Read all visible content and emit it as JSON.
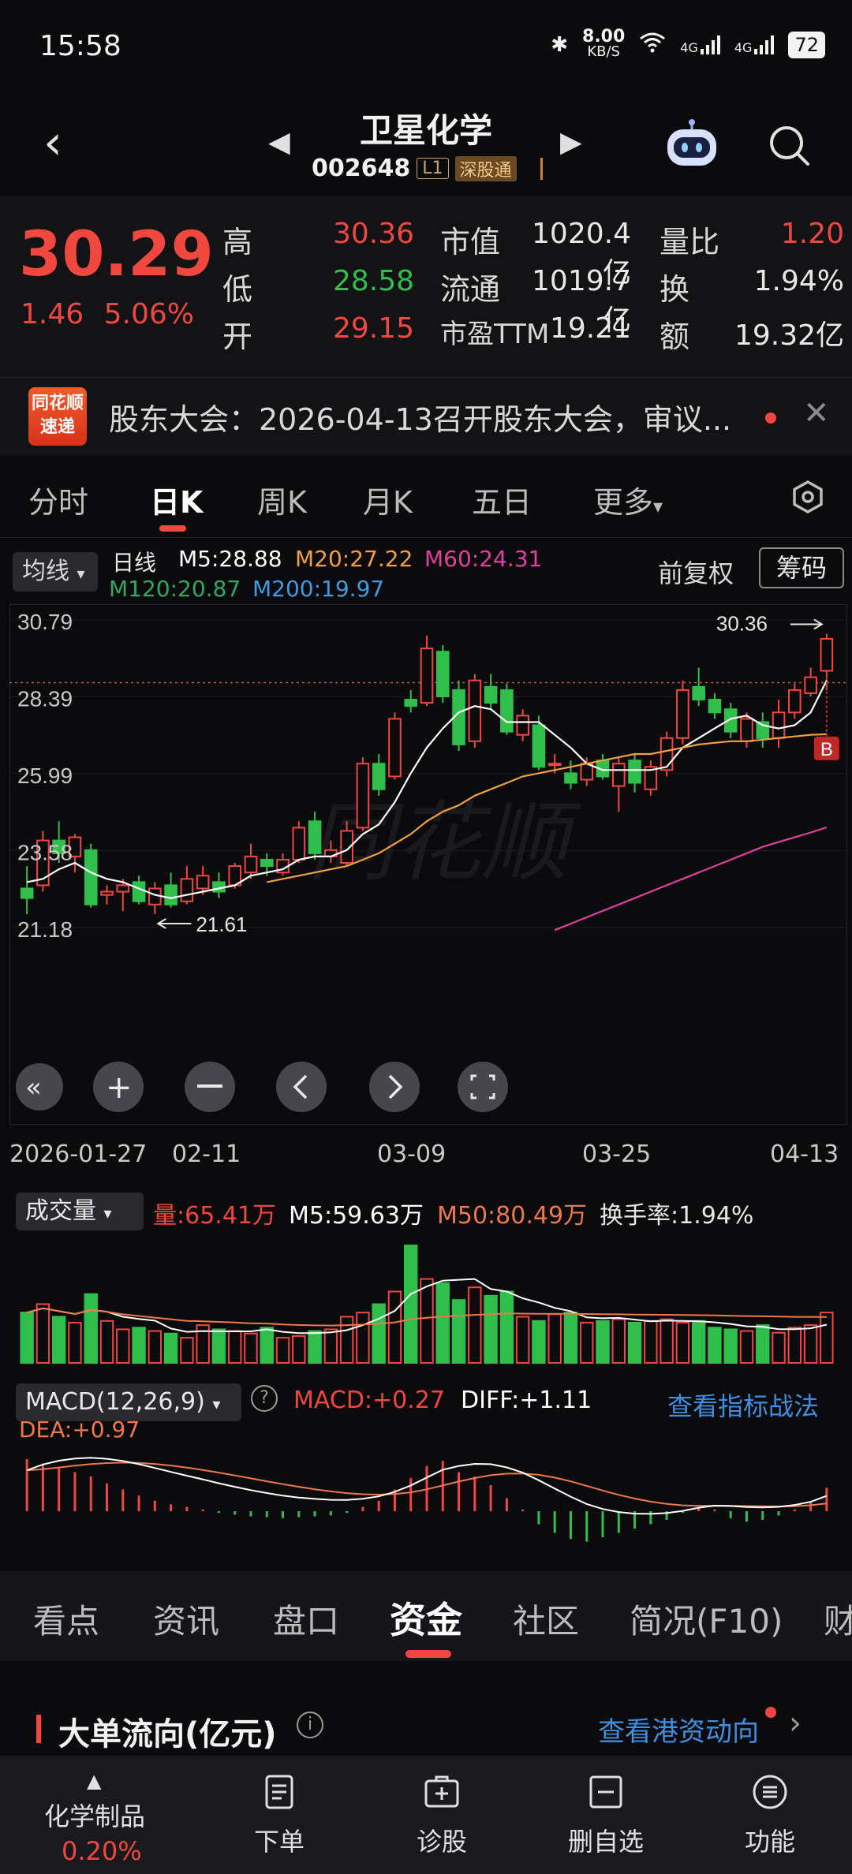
{
  "status_bar": {
    "time": "15:58",
    "network_speed": "8.00",
    "network_unit": "KB/S",
    "signal_1": "4G",
    "signal_2": "4G",
    "battery": "72"
  },
  "header": {
    "stock_name": "卫星化学",
    "stock_code": "002648",
    "tag_level": "L1",
    "tag_connect": "深股通"
  },
  "quote": {
    "last_price": "30.29",
    "change": "1.46",
    "change_pct": "5.06%",
    "high_label": "高",
    "high": "30.36",
    "low_label": "低",
    "low": "28.58",
    "open_label": "开",
    "open": "29.15",
    "mcap_label": "市值",
    "mcap": "1020.4亿",
    "float_label": "流通",
    "float": "1019.7亿",
    "pe_label": "市盈TTM",
    "pe": "19.21",
    "volratio_label": "量比",
    "volratio": "1.20",
    "turnover_label": "换",
    "turnover": "1.94%",
    "amount_label": "额",
    "amount": "19.32亿"
  },
  "news": {
    "logo_line1": "同花顺",
    "logo_line2": "速递",
    "text": "股东大会：2026-04-13召开股东大会，审议..."
  },
  "period_tabs": [
    "分时",
    "日K",
    "周K",
    "月K",
    "五日",
    "更多"
  ],
  "period_active": "日K",
  "ma_legend": {
    "selector": "均线",
    "period": "日线",
    "m5": "M5:28.88",
    "m20": "M20:27.22",
    "m60": "M60:24.31",
    "m120": "M120:20.87",
    "m200": "M200:19.97",
    "adjust": "前复权",
    "chips": "筹码"
  },
  "colors": {
    "up": "#f0473f",
    "down": "#2fbf4a",
    "m5": "#ffffff",
    "m20": "#f0a040",
    "m60": "#e040a0",
    "m120": "#2fa860",
    "m200": "#3f9be0"
  },
  "chart_data": {
    "type": "candlestick",
    "y_ticks": [
      "30.79",
      "28.39",
      "25.99",
      "23.58",
      "21.18"
    ],
    "ylim": [
      21.18,
      30.79
    ],
    "high_marker": "30.36",
    "low_marker": "21.61",
    "reference_price": 28.83,
    "buy_marker": "B",
    "x_ticks": [
      "2026-01-27",
      "02-11",
      "03-09",
      "03-25",
      "04-13"
    ],
    "candles": [
      {
        "o": 22.4,
        "c": 22.1,
        "h": 23.1,
        "l": 21.6
      },
      {
        "o": 22.5,
        "c": 23.9,
        "h": 24.2,
        "l": 22.3
      },
      {
        "o": 23.9,
        "c": 23.5,
        "h": 24.5,
        "l": 23.2
      },
      {
        "o": 23.4,
        "c": 24.0,
        "h": 24.1,
        "l": 22.9
      },
      {
        "o": 23.6,
        "c": 21.9,
        "h": 23.8,
        "l": 21.8
      },
      {
        "o": 22.2,
        "c": 22.3,
        "h": 22.5,
        "l": 21.9
      },
      {
        "o": 22.3,
        "c": 22.5,
        "h": 22.7,
        "l": 21.7
      },
      {
        "o": 22.6,
        "c": 22.0,
        "h": 22.8,
        "l": 21.9
      },
      {
        "o": 21.9,
        "c": 22.4,
        "h": 22.6,
        "l": 21.6
      },
      {
        "o": 22.5,
        "c": 21.9,
        "h": 22.9,
        "l": 21.8
      },
      {
        "o": 22.0,
        "c": 22.7,
        "h": 23.1,
        "l": 21.9
      },
      {
        "o": 22.4,
        "c": 22.8,
        "h": 23.1,
        "l": 22.2
      },
      {
        "o": 22.6,
        "c": 22.3,
        "h": 22.9,
        "l": 22.1
      },
      {
        "o": 22.5,
        "c": 23.1,
        "h": 23.2,
        "l": 22.4
      },
      {
        "o": 22.9,
        "c": 23.4,
        "h": 23.8,
        "l": 22.7
      },
      {
        "o": 23.3,
        "c": 23.1,
        "h": 23.5,
        "l": 22.8
      },
      {
        "o": 22.9,
        "c": 23.3,
        "h": 23.5,
        "l": 22.8
      },
      {
        "o": 23.3,
        "c": 24.3,
        "h": 24.5,
        "l": 23.2
      },
      {
        "o": 24.5,
        "c": 23.5,
        "h": 24.8,
        "l": 23.3
      },
      {
        "o": 23.4,
        "c": 23.6,
        "h": 23.9,
        "l": 23.2
      },
      {
        "o": 23.2,
        "c": 24.2,
        "h": 24.5,
        "l": 23.1
      },
      {
        "o": 24.3,
        "c": 26.3,
        "h": 26.5,
        "l": 24.2
      },
      {
        "o": 26.3,
        "c": 25.5,
        "h": 26.6,
        "l": 25.3
      },
      {
        "o": 25.9,
        "c": 27.7,
        "h": 27.9,
        "l": 25.8
      },
      {
        "o": 28.3,
        "c": 28.1,
        "h": 28.6,
        "l": 27.9
      },
      {
        "o": 28.2,
        "c": 29.9,
        "h": 30.3,
        "l": 28.1
      },
      {
        "o": 29.8,
        "c": 28.4,
        "h": 30.0,
        "l": 28.2
      },
      {
        "o": 28.6,
        "c": 26.9,
        "h": 28.9,
        "l": 26.7
      },
      {
        "o": 27.0,
        "c": 28.9,
        "h": 29.1,
        "l": 26.8
      },
      {
        "o": 28.7,
        "c": 28.2,
        "h": 29.1,
        "l": 28.0
      },
      {
        "o": 28.6,
        "c": 27.3,
        "h": 28.8,
        "l": 27.2
      },
      {
        "o": 27.2,
        "c": 27.8,
        "h": 28.0,
        "l": 27.0
      },
      {
        "o": 27.5,
        "c": 26.2,
        "h": 27.8,
        "l": 26.1
      },
      {
        "o": 26.3,
        "c": 26.3,
        "h": 26.6,
        "l": 26.0
      },
      {
        "o": 26.0,
        "c": 25.7,
        "h": 26.4,
        "l": 25.5
      },
      {
        "o": 25.8,
        "c": 26.3,
        "h": 26.5,
        "l": 25.6
      },
      {
        "o": 26.4,
        "c": 25.9,
        "h": 26.6,
        "l": 25.8
      },
      {
        "o": 25.6,
        "c": 26.3,
        "h": 26.5,
        "l": 24.8
      },
      {
        "o": 26.4,
        "c": 25.7,
        "h": 26.6,
        "l": 25.4
      },
      {
        "o": 25.5,
        "c": 26.2,
        "h": 26.4,
        "l": 25.3
      },
      {
        "o": 26.1,
        "c": 27.1,
        "h": 27.3,
        "l": 25.9
      },
      {
        "o": 27.1,
        "c": 28.6,
        "h": 28.9,
        "l": 26.9
      },
      {
        "o": 28.7,
        "c": 28.3,
        "h": 29.3,
        "l": 28.1
      },
      {
        "o": 28.3,
        "c": 27.9,
        "h": 28.5,
        "l": 27.7
      },
      {
        "o": 28.0,
        "c": 27.3,
        "h": 28.2,
        "l": 27.1
      },
      {
        "o": 27.0,
        "c": 27.7,
        "h": 27.9,
        "l": 26.8
      },
      {
        "o": 27.6,
        "c": 27.1,
        "h": 27.9,
        "l": 26.8
      },
      {
        "o": 27.1,
        "c": 27.9,
        "h": 28.3,
        "l": 26.8
      },
      {
        "o": 27.9,
        "c": 28.6,
        "h": 28.8,
        "l": 27.7
      },
      {
        "o": 28.5,
        "c": 29.0,
        "h": 29.3,
        "l": 28.4
      },
      {
        "o": 29.2,
        "c": 30.2,
        "h": 30.36,
        "l": 28.6
      }
    ],
    "ma5": [
      22.6,
      22.7,
      23.0,
      23.2,
      22.9,
      22.7,
      22.6,
      22.4,
      22.2,
      22.1,
      22.2,
      22.3,
      22.4,
      22.5,
      22.8,
      22.9,
      23.0,
      23.3,
      23.4,
      23.4,
      23.6,
      24.1,
      24.4,
      25.1,
      26.0,
      26.8,
      27.4,
      27.9,
      28.1,
      28.0,
      27.6,
      27.6,
      27.6,
      27.2,
      26.8,
      26.3,
      26.1,
      26.1,
      26.1,
      26.1,
      26.2,
      26.8,
      27.1,
      27.4,
      27.7,
      27.8,
      27.5,
      27.4,
      27.5,
      27.9,
      28.9
    ],
    "ma20": [
      null,
      null,
      null,
      null,
      null,
      null,
      null,
      null,
      null,
      null,
      null,
      null,
      null,
      null,
      null,
      22.6,
      22.7,
      22.8,
      22.9,
      23.0,
      23.1,
      23.3,
      23.5,
      23.8,
      24.1,
      24.5,
      24.8,
      25.0,
      25.3,
      25.5,
      25.7,
      25.9,
      26.0,
      26.1,
      26.2,
      26.3,
      26.4,
      26.5,
      26.6,
      26.6,
      26.7,
      26.8,
      26.9,
      26.95,
      27.0,
      27.0,
      27.05,
      27.1,
      27.15,
      27.2,
      27.22
    ],
    "ma60": [
      null,
      null,
      null,
      null,
      null,
      null,
      null,
      null,
      null,
      null,
      null,
      null,
      null,
      null,
      null,
      null,
      null,
      null,
      null,
      null,
      null,
      null,
      null,
      null,
      null,
      null,
      null,
      null,
      null,
      null,
      null,
      null,
      null,
      21.1,
      21.3,
      21.5,
      21.7,
      21.9,
      22.1,
      22.3,
      22.5,
      22.7,
      22.9,
      23.1,
      23.3,
      23.5,
      23.7,
      23.85,
      24.0,
      24.15,
      24.31
    ],
    "volume": {
      "label": "成交量",
      "vol": "量:65.41万",
      "m5": "M5:59.63万",
      "m50": "M50:80.49万",
      "turnover": "换手率:1.94%",
      "bars": [
        60,
        70,
        55,
        48,
        82,
        50,
        40,
        42,
        38,
        35,
        30,
        45,
        40,
        38,
        35,
        42,
        30,
        32,
        38,
        40,
        55,
        60,
        70,
        85,
        140,
        100,
        95,
        75,
        90,
        80,
        85,
        55,
        50,
        58,
        60,
        48,
        50,
        52,
        48,
        50,
        52,
        48,
        50,
        42,
        40,
        38,
        45,
        36,
        42,
        45,
        60
      ]
    },
    "macd": {
      "selector": "MACD(12,26,9)",
      "macd": "MACD:+0.27",
      "diff": "DIFF:+1.11",
      "dea": "DEA:+0.97",
      "link": "查看指标战法",
      "hist": [
        0.6,
        0.55,
        0.5,
        0.45,
        0.4,
        0.32,
        0.25,
        0.18,
        0.12,
        0.08,
        0.05,
        0.02,
        -0.02,
        -0.04,
        -0.06,
        -0.07,
        -0.08,
        -0.07,
        -0.06,
        -0.05,
        -0.02,
        0.05,
        0.12,
        0.25,
        0.38,
        0.52,
        0.58,
        0.45,
        0.4,
        0.3,
        0.15,
        0.02,
        -0.15,
        -0.25,
        -0.32,
        -0.35,
        -0.3,
        -0.25,
        -0.2,
        -0.15,
        -0.1,
        -0.02,
        0.05,
        0.02,
        -0.08,
        -0.12,
        -0.1,
        -0.05,
        0.02,
        0.1,
        0.27
      ]
    }
  },
  "info_tabs": [
    "看点",
    "资讯",
    "盘口",
    "资金",
    "社区",
    "简况(F10)",
    "财"
  ],
  "info_active": "资金",
  "flow": {
    "title": "大单流向(亿元)",
    "info_icon": "i",
    "link": "查看港资动向"
  },
  "bottom_nav": {
    "sector_name": "化学制品",
    "sector_change": "0.20%",
    "items": [
      "下单",
      "诊股",
      "删自选",
      "功能"
    ]
  }
}
